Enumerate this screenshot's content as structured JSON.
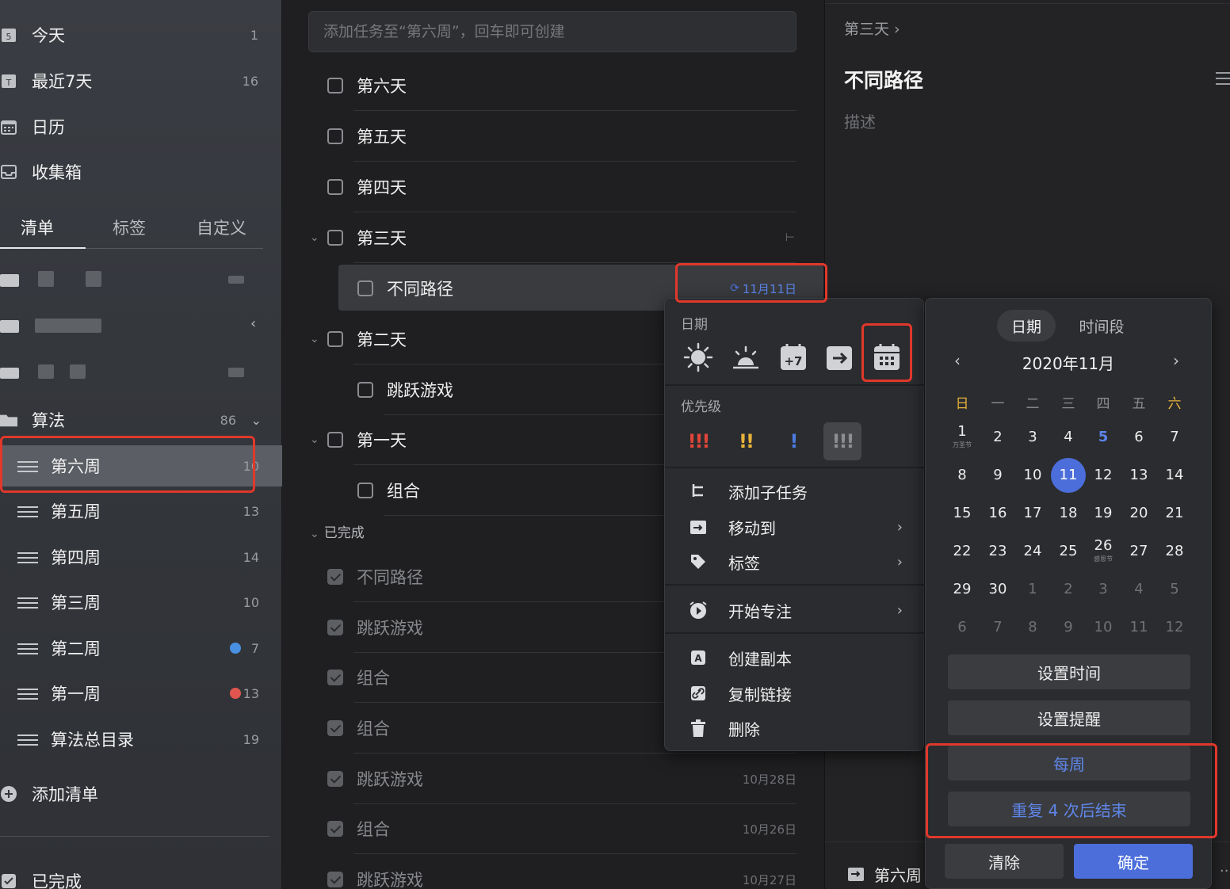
{
  "sidebar": {
    "smart": [
      {
        "label": "今天",
        "count": "1",
        "icon": "calendar-day-icon",
        "badge": "5"
      },
      {
        "label": "最近7天",
        "count": "16",
        "icon": "calendar-week-icon",
        "badge": "T"
      },
      {
        "label": "日历",
        "count": "",
        "icon": "calendar-grid-icon"
      },
      {
        "label": "收集箱",
        "count": "",
        "icon": "inbox-icon"
      }
    ],
    "tabs": [
      "清单",
      "标签",
      "自定义"
    ],
    "folder": {
      "label": "算法",
      "count": "86"
    },
    "lists": [
      {
        "label": "第六周",
        "count": "10"
      },
      {
        "label": "第五周",
        "count": "13"
      },
      {
        "label": "第四周",
        "count": "14"
      },
      {
        "label": "第三周",
        "count": "10"
      },
      {
        "label": "第二周",
        "count": "7",
        "dot": "#4a90e2"
      },
      {
        "label": "第一周",
        "count": "13",
        "dot": "#e0564f"
      },
      {
        "label": "算法总目录",
        "count": "19"
      }
    ],
    "add_list": "添加清单",
    "completed": "已完成"
  },
  "tasklist": {
    "add_placeholder": "添加任务至“第六周”，回车即可创建",
    "tasks": [
      {
        "title": "第六天"
      },
      {
        "title": "第五天"
      },
      {
        "title": "第四天"
      },
      {
        "title": "第三天"
      },
      {
        "title": "不同路径",
        "date": "11月11日"
      },
      {
        "title": "第二天"
      },
      {
        "title": "跳跃游戏"
      },
      {
        "title": "第一天"
      },
      {
        "title": "组合"
      }
    ],
    "done_header": "已完成",
    "done": [
      {
        "title": "不同路径",
        "date": ""
      },
      {
        "title": "跳跃游戏",
        "date": ""
      },
      {
        "title": "组合",
        "date": ""
      },
      {
        "title": "组合",
        "date": ""
      },
      {
        "title": "跳跃游戏",
        "date": "10月28日"
      },
      {
        "title": "组合",
        "date": "10月26日"
      },
      {
        "title": "跳跃游戏",
        "date": "10月27日"
      }
    ]
  },
  "detail": {
    "breadcrumb": "第三天 ›",
    "title": "不同路径",
    "description_placeholder": "描述",
    "footer_list": "第六周"
  },
  "context_menu": {
    "date_label": "日期",
    "priority_label": "优先级",
    "priorities": [
      {
        "glyph": "!!!",
        "color": "#e0453a"
      },
      {
        "glyph": "!!",
        "color": "#e8b33a"
      },
      {
        "glyph": "!",
        "color": "#4a7be0"
      },
      {
        "glyph": "!!!",
        "color": "#8c8e92"
      }
    ],
    "items": [
      {
        "label": "添加子任务",
        "icon": "subtask-icon",
        "submenu": false
      },
      {
        "label": "移动到",
        "icon": "move-icon",
        "submenu": true
      },
      {
        "label": "标签",
        "icon": "tag-icon",
        "submenu": true
      },
      {
        "label": "开始专注",
        "icon": "focus-timer-icon",
        "submenu": true
      },
      {
        "label": "创建副本",
        "icon": "duplicate-icon",
        "submenu": false
      },
      {
        "label": "复制链接",
        "icon": "link-icon",
        "submenu": false
      },
      {
        "label": "删除",
        "icon": "trash-icon",
        "submenu": false
      }
    ]
  },
  "picker": {
    "tabs": [
      "日期",
      "时间段"
    ],
    "month_title": "2020年11月",
    "weekdays": [
      "日",
      "一",
      "二",
      "三",
      "四",
      "五",
      "六"
    ],
    "weeks": [
      [
        "1",
        "2",
        "3",
        "4",
        "5",
        "6",
        "7"
      ],
      [
        "8",
        "9",
        "10",
        "11",
        "12",
        "13",
        "14"
      ],
      [
        "15",
        "16",
        "17",
        "18",
        "19",
        "20",
        "21"
      ],
      [
        "22",
        "23",
        "24",
        "25",
        "26",
        "27",
        "28"
      ],
      [
        "29",
        "30",
        "1",
        "2",
        "3",
        "4",
        "5"
      ],
      [
        "6",
        "7",
        "8",
        "9",
        "10",
        "11",
        "12"
      ]
    ],
    "holidays": {
      "1": "万圣节",
      "26": "感恩节"
    },
    "today": "5",
    "selected": "11",
    "set_time": "设置时间",
    "set_reminder": "设置提醒",
    "repeat": "每周",
    "repeat_end": "重复 4 次后结束",
    "clear": "清除",
    "confirm": "确定"
  },
  "colors": {
    "accent": "#4c6edb",
    "highlight": "#e0382b",
    "weekend": "#e8b33a"
  }
}
